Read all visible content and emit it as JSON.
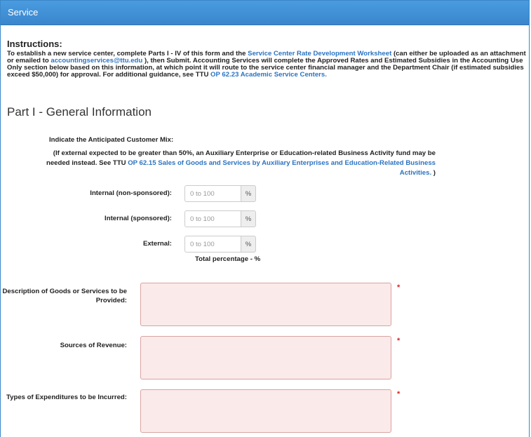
{
  "header": {
    "title": "Service"
  },
  "instructions": {
    "title": "Instructions:",
    "text1": "To establish a new service center, complete Parts I - IV of this form and the ",
    "link1": "Service Center Rate Development Worksheet",
    "text2": " (can either be uploaded as an attachment or emailed to ",
    "link2": "accountingservices@ttu.edu",
    "text3": " ), then Submit. Accounting Services will complete the Approved Rates and Estimated Subsidies in the Accounting Use Only section below based on this information, at which point it will route to the service center financial manager and the Department Chair (if estimated subsidies exceed $50,000) for approval. For additional guidance, see TTU ",
    "link3": "OP 62.23 Academic Service Centers.",
    "text4": ""
  },
  "part1": {
    "title": "Part I - General Information",
    "mix_label": "Indicate the Anticipated Customer Mix:",
    "mix_note_text": "(If external expected to be greater than 50%, an Auxiliary Enterprise or Education-related Business Activity fund may be needed instead. See TTU ",
    "mix_note_link": "OP 62.15 Sales of Goods and Services by Auxiliary Enterprises and Education-Related Business Activities.",
    "mix_note_end": " )",
    "rows": [
      {
        "label": "Internal (non-sponsored):",
        "placeholder": "0 to 100",
        "addon": "%"
      },
      {
        "label": "Internal (sponsored):",
        "placeholder": "0 to 100",
        "addon": "%"
      },
      {
        "label": "External:",
        "placeholder": "0 to 100",
        "addon": "%"
      }
    ],
    "total": "Total percentage - %",
    "description_label": "Description of Goods or Services to be Provided:",
    "revenue_label": "Sources of Revenue:",
    "expenditures_label": "Types of Expenditures to be Incurred:",
    "required_marker": "*"
  }
}
